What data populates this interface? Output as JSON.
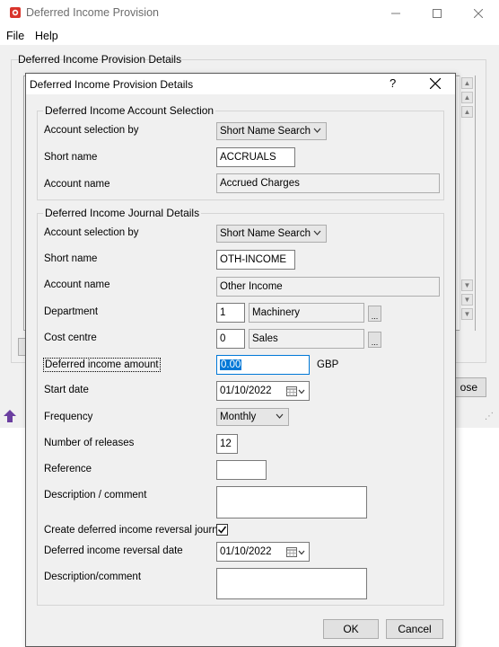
{
  "main_window": {
    "title": "Deferred Income Provision",
    "menu": [
      "File",
      "Help"
    ],
    "group_label": "Deferred Income Provision Details",
    "close_button_label": "ose"
  },
  "dialog": {
    "title": "Deferred Income Provision Details",
    "help_glyph": "?",
    "account_section": {
      "label": "Deferred Income Account Selection",
      "selection_by_label": "Account selection by",
      "selection_by_value": "Short Name Search",
      "short_name_label": "Short name",
      "short_name_value": "ACCRUALS",
      "account_name_label": "Account name",
      "account_name_value": "Accrued Charges"
    },
    "journal_section": {
      "label": "Deferred Income Journal Details",
      "selection_by_label": "Account selection by",
      "selection_by_value": "Short Name Search",
      "short_name_label": "Short name",
      "short_name_value": "OTH-INCOME",
      "account_name_label": "Account name",
      "account_name_value": "Other Income",
      "department_label": "Department",
      "department_code": "1",
      "department_name": "Machinery",
      "cost_centre_label": "Cost centre",
      "cost_centre_code": "0",
      "cost_centre_name": "Sales",
      "lookup_glyph": "...",
      "amount_label": "Deferred income amount",
      "amount_value": "0.00",
      "currency": "GBP",
      "start_date_label": "Start date",
      "start_date_value": "01/10/2022",
      "frequency_label": "Frequency",
      "frequency_value": "Monthly",
      "releases_label": "Number of releases",
      "releases_value": "12",
      "reference_label": "Reference",
      "reference_value": "",
      "description_label": "Description / comment",
      "description_value": "",
      "reversal_label": "Create deferred income reversal journal",
      "reversal_checked": true,
      "reversal_date_label": "Deferred income reversal date",
      "reversal_date_value": "01/10/2022",
      "description2_label": "Description/comment",
      "description2_value": ""
    },
    "buttons": {
      "ok": "OK",
      "cancel": "Cancel"
    }
  },
  "colors": {
    "selection": "#0078d7",
    "app_icon": "#d9342b",
    "status_icon": "#6b3fa0"
  },
  "icons": [
    "app-icon",
    "minimize-icon",
    "maximize-icon",
    "close-icon",
    "help-icon",
    "calendar-icon",
    "dropdown-arrow-icon",
    "checkmark-icon",
    "up-arrow-icon",
    "resize-grip-icon"
  ]
}
